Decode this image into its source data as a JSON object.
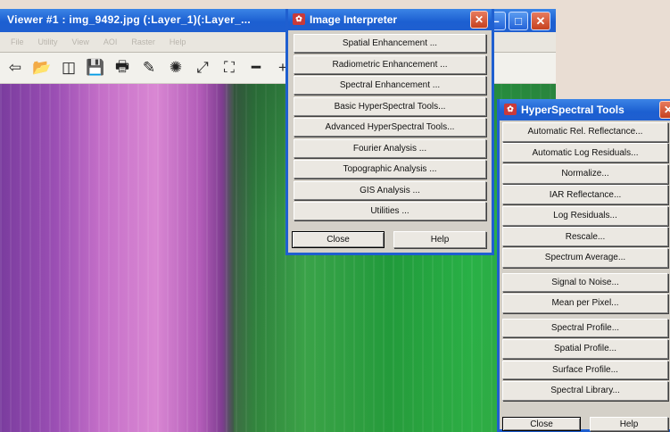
{
  "viewer": {
    "title": "Viewer #1 : img_9492.jpg (:Layer_1)(:Layer_...",
    "menu": [
      "File",
      "Utility",
      "View",
      "AOI",
      "Raster",
      "Help"
    ],
    "toolbar": [
      {
        "icon": "new-viewer-icon",
        "glyph": "⇦"
      },
      {
        "icon": "open-folder-icon",
        "glyph": "📂"
      },
      {
        "icon": "layer-info-icon",
        "glyph": "◫"
      },
      {
        "icon": "save-icon",
        "glyph": "💾"
      },
      {
        "icon": "print-icon",
        "glyph": "🖶"
      },
      {
        "icon": "eraser-icon",
        "glyph": "✎"
      },
      {
        "icon": "inquire-cursor-icon",
        "glyph": "✺"
      },
      {
        "icon": "zoom-in-icon",
        "glyph": "⤢"
      },
      {
        "icon": "fit-window-icon",
        "glyph": "⛶"
      },
      {
        "icon": "line-tool-icon",
        "glyph": "━"
      },
      {
        "icon": "crosshair-icon",
        "glyph": "+"
      }
    ]
  },
  "interpreter": {
    "title": "Image Interpreter",
    "items": [
      "Spatial Enhancement ...",
      "Radiometric Enhancement ...",
      "Spectral Enhancement ...",
      "Basic HyperSpectral Tools...",
      "Advanced HyperSpectral Tools...",
      "Fourier Analysis ...",
      "Topographic Analysis ...",
      "GIS Analysis ...",
      "Utilities ..."
    ],
    "close_label": "Close",
    "help_label": "Help"
  },
  "hyperspectral": {
    "title": "HyperSpectral Tools",
    "groups": [
      [
        "Automatic Rel. Reflectance...",
        "Automatic Log Residuals...",
        "Normalize...",
        "IAR Reflectance...",
        "Log Residuals...",
        "Rescale...",
        "Spectrum Average..."
      ],
      [
        "Signal to Noise...",
        "Mean per Pixel..."
      ],
      [
        "Spectral Profile...",
        "Spatial Profile...",
        "Surface Profile...",
        "Spectral Library..."
      ]
    ],
    "close_label": "Close",
    "help_label": "Help"
  }
}
